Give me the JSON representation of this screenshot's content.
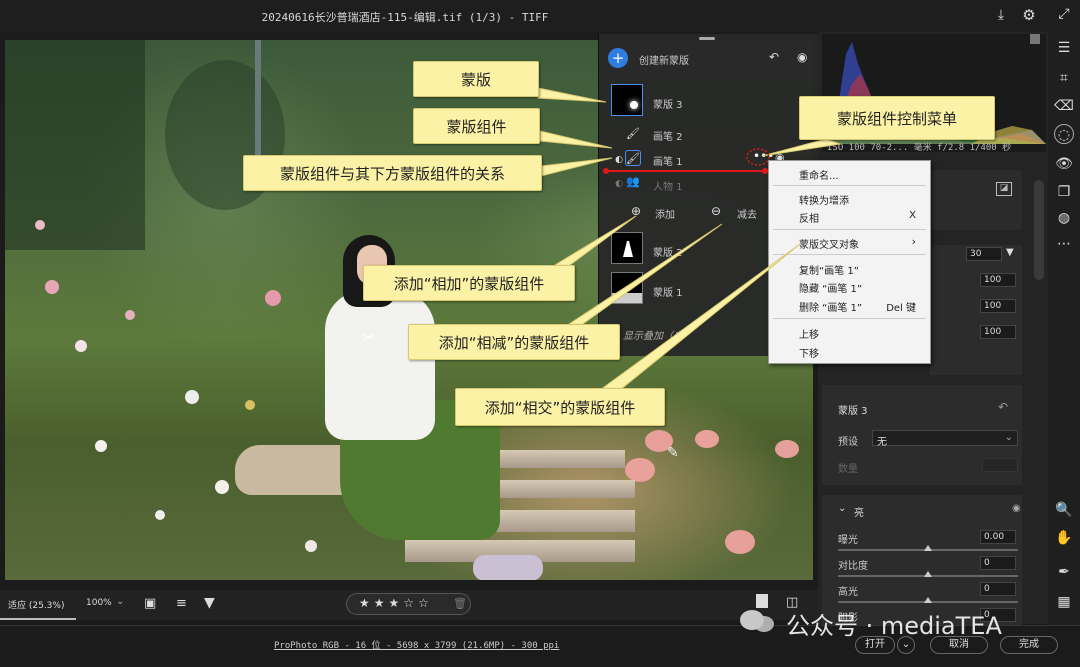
{
  "titlebar": {
    "title": "20240616长沙普瑞酒店-115-编辑.tif (1/3) -  TIFF",
    "icons": [
      "export-icon",
      "gear-icon",
      "expand-icon"
    ]
  },
  "mask_panel": {
    "create_label": "创建新蒙版",
    "masks": [
      {
        "name": "蒙版 3",
        "components": [
          "画笔 2",
          "画笔 1",
          "人物 1"
        ]
      },
      {
        "name": "蒙版 2"
      },
      {
        "name": "蒙版 1"
      }
    ],
    "add_label": "添加",
    "subtract_label": "减去",
    "show_overlay_label": "显示叠加（自"
  },
  "callouts": {
    "mask": "蒙版",
    "mask_component": "蒙版组件",
    "relation": "蒙版组件与其下方蒙版组件的关系",
    "control_menu": "蒙版组件控制菜单",
    "add_plus": "添加“相加”的蒙版组件",
    "add_minus": "添加“相减”的蒙版组件",
    "add_intersect": "添加“相交”的蒙版组件"
  },
  "context_menu": {
    "rename": "重命名...",
    "to_increase": "转换为增添",
    "invert": "反相",
    "invert_key": "X",
    "intersect": "蒙版交叉对象",
    "duplicate": "复制“画笔 1”",
    "hide": "隐藏 “画笔 1”",
    "delete": "删除 “画笔 1”",
    "delete_key": "Del 键",
    "move_up": "上移",
    "move_down": "下移"
  },
  "histogram": {
    "info": "ISO 100   70-2...  毫米     f/2.8   1/400 秒"
  },
  "right_panel": {
    "value_30": "30",
    "values_100": [
      "100",
      "100",
      "100"
    ],
    "mask_title": "蒙版 3",
    "preset_label": "预设",
    "preset_value": "无",
    "amount_label": "数量",
    "light_section": "亮",
    "exposure_label": "曝光",
    "exposure_value": "0.00",
    "contrast_label": "对比度",
    "contrast_value": "0",
    "highlights_label": "高光",
    "highlights_value": "0",
    "shadows_label": "阴影",
    "shadows_value": "0"
  },
  "bottom_toolbar": {
    "fit_label": "适应 (25.3%)",
    "zoom_label": "100%",
    "rating_stars": 3,
    "rating_max": 5
  },
  "status_bar": {
    "info": "ProPhoto RGB - 16 位 - 5698 x 3799 (21.6MP) - 300 ppi",
    "open_label": "打开",
    "cancel_label": "取消",
    "done_label": "完成",
    "watermark": "公众号 · mediaTEA"
  }
}
